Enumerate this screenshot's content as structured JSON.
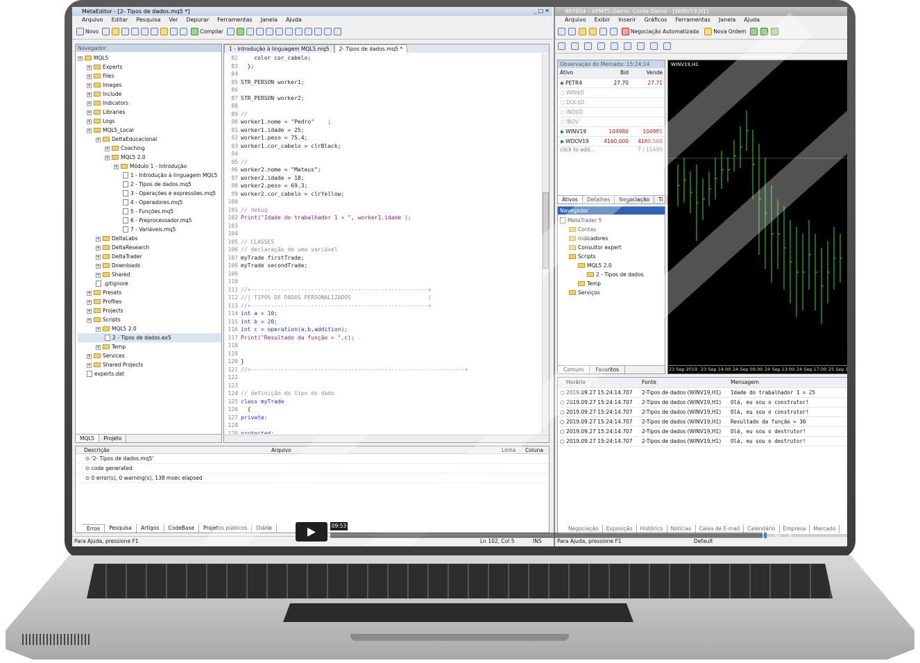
{
  "editor": {
    "title": "MetaEditor - [2- Tipos de dados.mq5 *]",
    "menu": [
      "Arquivo",
      "Editar",
      "Pesquisa",
      "Ver",
      "Depurar",
      "Ferramentas",
      "Janela",
      "Ajuda"
    ],
    "toolbar": {
      "new_label": "Novo",
      "compile_label": "Compilar"
    },
    "navigator_title": "Navegador",
    "tree": [
      {
        "label": "MQL5",
        "indent": 0,
        "kind": "root"
      },
      {
        "label": "Experts",
        "indent": 1,
        "kind": "folder"
      },
      {
        "label": "Files",
        "indent": 1,
        "kind": "folder"
      },
      {
        "label": "Images",
        "indent": 1,
        "kind": "folder"
      },
      {
        "label": "Include",
        "indent": 1,
        "kind": "folder"
      },
      {
        "label": "Indicators",
        "indent": 1,
        "kind": "folder"
      },
      {
        "label": "Libraries",
        "indent": 1,
        "kind": "folder"
      },
      {
        "label": "Logs",
        "indent": 1,
        "kind": "folder"
      },
      {
        "label": "MQL5_Local",
        "indent": 1,
        "kind": "folder"
      },
      {
        "label": "DeltaEducacional",
        "indent": 2,
        "kind": "folder"
      },
      {
        "label": "Coaching",
        "indent": 3,
        "kind": "folder"
      },
      {
        "label": "MQL5 2.0",
        "indent": 3,
        "kind": "folder"
      },
      {
        "label": "Módulo 1 - Introdução",
        "indent": 4,
        "kind": "folder"
      },
      {
        "label": "1 - Introdução à linguagem MQL5",
        "indent": 5,
        "kind": "file"
      },
      {
        "label": "2 - Tipos de dados.mq5",
        "indent": 5,
        "kind": "file"
      },
      {
        "label": "3 - Operações e expressões.mq5",
        "indent": 5,
        "kind": "file"
      },
      {
        "label": "4 - Operadores.mq5",
        "indent": 5,
        "kind": "file"
      },
      {
        "label": "5 - Funções.mq5",
        "indent": 5,
        "kind": "file"
      },
      {
        "label": "6 - Preprocessador.mq5",
        "indent": 5,
        "kind": "file"
      },
      {
        "label": "7 - Variáveis.mq5",
        "indent": 5,
        "kind": "file"
      },
      {
        "label": "DeltaLabs",
        "indent": 2,
        "kind": "folder"
      },
      {
        "label": "DeltaResearch",
        "indent": 2,
        "kind": "folder"
      },
      {
        "label": "DeltaTrader",
        "indent": 2,
        "kind": "folder"
      },
      {
        "label": "Downloads",
        "indent": 2,
        "kind": "folder"
      },
      {
        "label": "Shared",
        "indent": 2,
        "kind": "folder"
      },
      {
        "label": ".gitignore",
        "indent": 2,
        "kind": "file"
      },
      {
        "label": "Presets",
        "indent": 1,
        "kind": "folder"
      },
      {
        "label": "Profiles",
        "indent": 1,
        "kind": "folder"
      },
      {
        "label": "Projects",
        "indent": 1,
        "kind": "folder"
      },
      {
        "label": "Scripts",
        "indent": 1,
        "kind": "folder"
      },
      {
        "label": "MQL5 2.0",
        "indent": 2,
        "kind": "folder"
      },
      {
        "label": "2 - Tipos de dados.ex5",
        "indent": 3,
        "kind": "file"
      },
      {
        "label": "Temp",
        "indent": 2,
        "kind": "folder"
      },
      {
        "label": "Services",
        "indent": 1,
        "kind": "folder"
      },
      {
        "label": "Shared Projects",
        "indent": 1,
        "kind": "folder"
      },
      {
        "label": "experts.dat",
        "indent": 1,
        "kind": "file"
      }
    ],
    "nav_tabs": [
      "MQL5",
      "Projeto"
    ],
    "doc_tabs": [
      "1 - Introdução à linguagem MQL5.mq5",
      "2- Tipos de dados.mq5 *"
    ],
    "code": [
      {
        "n": "82",
        "t": "    color cor_cabelo;"
      },
      {
        "n": "83",
        "t": "  };"
      },
      {
        "n": "84",
        "t": ""
      },
      {
        "n": "85",
        "t": "STR_PERSON worker1;"
      },
      {
        "n": "86",
        "t": ""
      },
      {
        "n": "87",
        "t": "STR_PERSON worker2;"
      },
      {
        "n": "88",
        "t": ""
      },
      {
        "n": "89",
        "t": "//"
      },
      {
        "n": "90",
        "t": "worker1.nome = \"Pedro\"    ;"
      },
      {
        "n": "91",
        "t": "worker1.idade = 25;"
      },
      {
        "n": "92",
        "t": "worker1.peso = 75.4;"
      },
      {
        "n": "93",
        "t": "worker1.cor_cabelo = clrBlack;"
      },
      {
        "n": "94",
        "t": ""
      },
      {
        "n": "95",
        "t": "//"
      },
      {
        "n": "96",
        "t": "worker2.nome = \"Mateus\";"
      },
      {
        "n": "97",
        "t": "worker2.idade = 18;"
      },
      {
        "n": "98",
        "t": "worker2.peso = 69.3;"
      },
      {
        "n": "99",
        "t": "worker2.cor_cabelo = clrYellow;"
      },
      {
        "n": "100",
        "t": ""
      },
      {
        "n": "101",
        "t": "// debug"
      },
      {
        "n": "102",
        "t": "Print(\"Idade do trabalhador 1 = \", worker1.idade );"
      },
      {
        "n": "103",
        "t": ""
      },
      {
        "n": "104",
        "t": ""
      },
      {
        "n": "105",
        "t": "// CLASSES"
      },
      {
        "n": "106",
        "t": "// declaração de uma variável"
      },
      {
        "n": "107",
        "t": "myTrade firstTrade;"
      },
      {
        "n": "108",
        "t": "myTrade secondTrade;"
      },
      {
        "n": "109",
        "t": ""
      },
      {
        "n": "110",
        "t": ""
      },
      {
        "n": "111",
        "t": "//+-----------------------------------------------------+"
      },
      {
        "n": "112",
        "t": "//| TIPOS DE DADOS PERSONALIZADOS                       |"
      },
      {
        "n": "113",
        "t": "//+-----------------------------------------------------+"
      },
      {
        "n": "114",
        "t": "int a = 10;"
      },
      {
        "n": "115",
        "t": "int b = 20;"
      },
      {
        "n": "116",
        "t": "int c = operation(a,b,addition);"
      },
      {
        "n": "117",
        "t": "Print(\"Resultado da função = \",c);"
      },
      {
        "n": "118",
        "t": ""
      },
      {
        "n": "119",
        "t": ""
      },
      {
        "n": "120",
        "t": "}"
      },
      {
        "n": "121",
        "t": "//+----------------------------------------------------------------+"
      },
      {
        "n": "122",
        "t": ""
      },
      {
        "n": "123",
        "t": ""
      },
      {
        "n": "124",
        "t": "// definição do tipo do dado"
      },
      {
        "n": "125",
        "t": "class myTrade"
      },
      {
        "n": "126",
        "t": "  {"
      },
      {
        "n": "127",
        "t": "private:"
      },
      {
        "n": "128",
        "t": ""
      },
      {
        "n": "129",
        "t": "protected:"
      }
    ],
    "errors": {
      "headers": [
        "Descrição",
        "Arquivo",
        "Linha",
        "Coluna"
      ],
      "rows": [
        "'2- Tipos de dados.mq5'",
        "code generated",
        "0 error(s), 0 warning(s), 138 msec elapsed"
      ]
    },
    "bottom_tabs": [
      "Erros",
      "Pesquisa",
      "Artigos",
      "CodeBase",
      "Projetos públicos",
      "Diário"
    ],
    "status": {
      "help": "Para Ajuda, pressione F1",
      "pos": "Ln 102, Col 5",
      "mode": "INS"
    }
  },
  "terminal": {
    "title": "987654 - XPMT5-Demo: Conta Demo - [WINV19,H1]",
    "menu": [
      "Arquivo",
      "Exibir",
      "Inserir",
      "Gráficos",
      "Ferramentas",
      "Janela",
      "Ajuda"
    ],
    "toolbar": {
      "algo_label": "Negociação Automatizada",
      "order_label": "Nova Ordem"
    },
    "market_watch": {
      "title": "Observação do Mercado: 15:24:14",
      "headers": [
        "Ativo",
        "Bid",
        "Vende"
      ],
      "rows": [
        {
          "symbol": "PETR4",
          "bid": "27.70",
          "ask": "27.71"
        },
        {
          "symbol": "WIN$D",
          "bid": "",
          "ask": ""
        },
        {
          "symbol": "DOL$D",
          "bid": "",
          "ask": ""
        },
        {
          "symbol": "IND$D",
          "bid": "",
          "ask": ""
        },
        {
          "symbol": "IBOV",
          "bid": "",
          "ask": ""
        },
        {
          "symbol": "WINV19",
          "bid": "104980",
          "ask": "104985"
        },
        {
          "symbol": "WDOV19",
          "bid": "4160.000",
          "ask": "4160.500"
        }
      ],
      "add_label": "click to add...",
      "count": "7 / 10499",
      "tabs": [
        "Ativos",
        "Detalhes",
        "Negociação",
        "Ti"
      ]
    },
    "navigator": {
      "title": "Navegador",
      "items": [
        {
          "label": "MetaTrader 5",
          "indent": 0
        },
        {
          "label": "Contas",
          "indent": 1
        },
        {
          "label": "Indicadores",
          "indent": 1
        },
        {
          "label": "Consultor expert",
          "indent": 1
        },
        {
          "label": "Scripts",
          "indent": 1
        },
        {
          "label": "MQL5 2.0",
          "indent": 2
        },
        {
          "label": "2 - Tipos de dados",
          "indent": 3
        },
        {
          "label": "Temp",
          "indent": 2
        },
        {
          "label": "Serviços",
          "indent": 1
        }
      ],
      "tabs": [
        "Comum",
        "Favoritos"
      ]
    },
    "chart": {
      "symbol_label": "WINV19,H1",
      "x_labels": [
        "23 Sep 2019",
        "23 Sep 14:00",
        "24 Sep 09:00",
        "24 Sep 13:00",
        "24 Sep 17:00",
        "25 Sep 1"
      ],
      "bar_color": "#2ee02e",
      "background": "#000000"
    },
    "journal": {
      "headers": [
        "Horário",
        "Fonte",
        "Mensagem"
      ],
      "rows": [
        {
          "time": "2019.09.27 15:24:14.707",
          "source": "2-Tipos de dados (WINV19,H1)",
          "msg": "Idade do trabalhador 1 = 25"
        },
        {
          "time": "2019.09.27 15:24:14.707",
          "source": "2-Tipos de dados (WINV19,H1)",
          "msg": "Olá, eu sou o construtor!"
        },
        {
          "time": "2019.09.27 15:24:14.707",
          "source": "2-Tipos de dados (WINV19,H1)",
          "msg": "Olá, eu sou o construtor!"
        },
        {
          "time": "2019.09.27 15:24:14.707",
          "source": "2-Tipos de dados (WINV19,H1)",
          "msg": "Resultado da função = 30"
        },
        {
          "time": "2019.09.27 15:24:14.707",
          "source": "2-Tipos de dados (WINV19,H1)",
          "msg": "Olá, eu sou o destrutor!"
        },
        {
          "time": "2019.09.27 15:24:14.707",
          "source": "2-Tipos de dados (WINV19,H1)",
          "msg": "Olá, eu sou o destrutor!"
        }
      ]
    },
    "bottom_tabs": [
      "Negociação",
      "Exposição",
      "Histórico",
      "Notícias",
      "Caixa de E-mail",
      "Calendário",
      "Empresa",
      "Mercado"
    ],
    "status": {
      "help": "Para Ajuda, pressione F1",
      "profile": "Default"
    }
  },
  "video": {
    "time": "09:53"
  }
}
